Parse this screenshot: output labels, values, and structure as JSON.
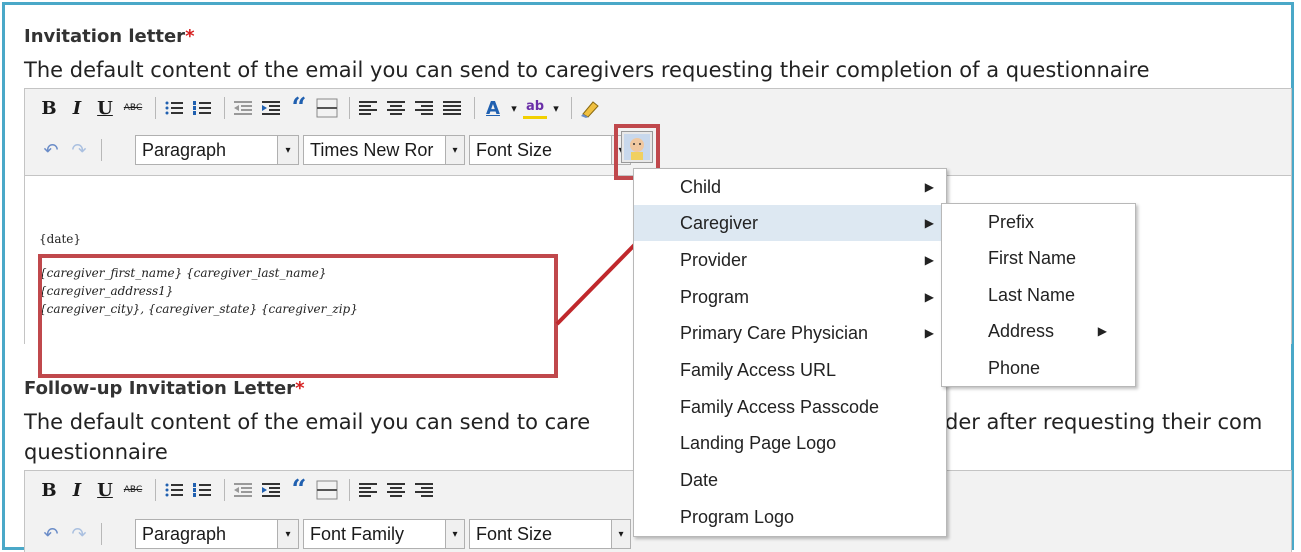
{
  "section1": {
    "title": "Invitation letter",
    "required_mark": "*",
    "description": "The default content of the email you can send to caregivers requesting their completion of a questionnaire"
  },
  "section2": {
    "title": "Follow-up Invitation Letter",
    "required_mark": "*",
    "description_left": "The default content of the email you can send to care",
    "description_right": "der after requesting their com",
    "description_line2": "questionnaire"
  },
  "toolbar": {
    "bold": "B",
    "italic": "I",
    "underline": "U",
    "strike": "ABC",
    "quote": "“",
    "undo": "↶",
    "redo": "↷",
    "color_a": "A",
    "highlight": "ab",
    "dropdown_arrow": "▾"
  },
  "editor1": {
    "format_value": "Paragraph",
    "font_family_value": "Times New Ror",
    "font_size_value": "Font Size",
    "content": {
      "date": "{date}",
      "line1": "{caregiver_first_name} {caregiver_last_name}",
      "line2": "{caregiver_address1}",
      "line3": "{caregiver_city}, {caregiver_state} {caregiver_zip}"
    }
  },
  "editor2": {
    "format_value": "Paragraph",
    "font_family_value": "Font Family",
    "font_size_value": "Font Size"
  },
  "context_menu": {
    "items": [
      {
        "label": "Child"
      },
      {
        "label": "Caregiver"
      },
      {
        "label": "Provider"
      },
      {
        "label": "Program"
      },
      {
        "label": "Primary Care Physician"
      },
      {
        "label": "Family Access URL"
      },
      {
        "label": "Family Access Passcode"
      },
      {
        "label": "Landing Page Logo"
      },
      {
        "label": "Date"
      },
      {
        "label": "Program Logo"
      }
    ],
    "highlighted": "Caregiver"
  },
  "submenu": {
    "items": [
      {
        "label": "Prefix"
      },
      {
        "label": "First Name"
      },
      {
        "label": "Last Name"
      },
      {
        "label": "Address"
      },
      {
        "label": "Phone"
      }
    ]
  },
  "colors": {
    "frame": "#4aa8c8",
    "highlight_box": "#c0484c",
    "arrow": "#c0282c",
    "menu_highlight": "#dde8f2",
    "required": "#d62020"
  }
}
